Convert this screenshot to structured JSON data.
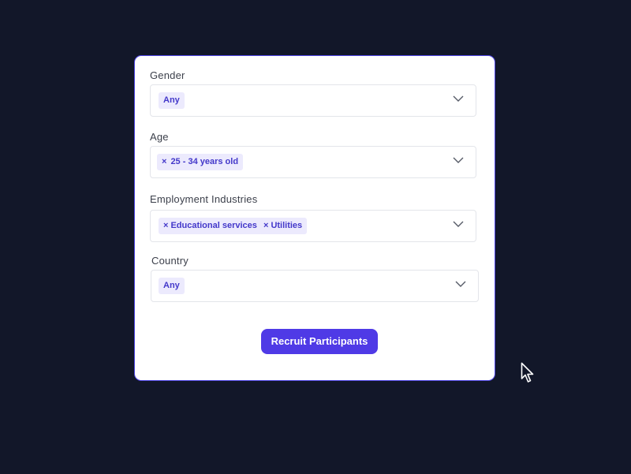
{
  "form": {
    "gender": {
      "label": "Gender",
      "chips": [
        {
          "text": "Any",
          "removable": false
        }
      ]
    },
    "age": {
      "label": "Age",
      "chips": [
        {
          "text": "25 - 34 years old",
          "removable": true
        }
      ]
    },
    "employment": {
      "label": "Employment Industries",
      "chips": [
        {
          "text": "Educational services",
          "removable": true
        },
        {
          "text": "Utilities",
          "removable": true
        }
      ]
    },
    "country": {
      "label": "Country",
      "chips": [
        {
          "text": "Any",
          "removable": false
        }
      ]
    },
    "submit_label": "Recruit Participants",
    "remove_glyph": "×"
  },
  "icons": {
    "dropdown": "chevron-down-icon",
    "remove": "close-icon",
    "pointer": "mouse-pointer-icon"
  },
  "colors": {
    "background": "#121729",
    "card": "#ffffff",
    "accent": "#4f46e5",
    "chip_bg": "#eceafd",
    "chip_text": "#4338ca"
  }
}
